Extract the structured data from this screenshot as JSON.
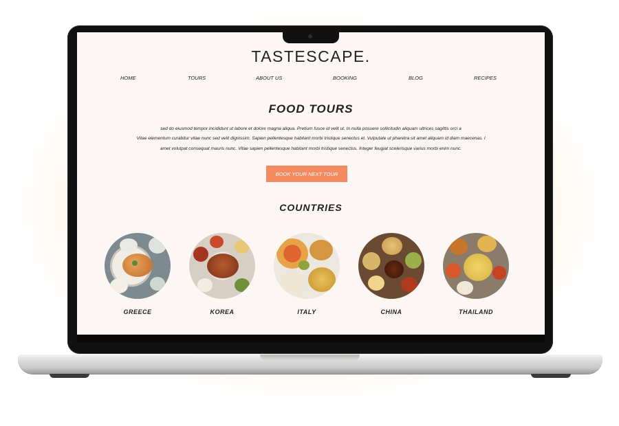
{
  "site": {
    "logo": "TASTESCAPE.",
    "nav": [
      "HOME",
      "TOURS",
      "ABOUT US",
      "BOOKING",
      "BLOG",
      "RECIPES"
    ],
    "hero": {
      "title": "FOOD TOURS",
      "lines": [
        "sed do eiusmod tempor incididunt ut labore et dolore magna aliqua. Pretium fusce id velit ut. In nulla posuere sollicitudin aliquam ultrices sagittis orci a",
        "Vitae elementum curabitur vitae nunc sed velit dignissim. Sapien pellentesque habitant morbi tristique senectus et. Vulputate ut pharetra sit amet aliquam id diam maecenas. l",
        "amet volutpat consequat mauris nunc. Vitae sapien pellentesque habitant morbi tristique senectus. Integer feugiat scelerisque varius morbi enim nunc."
      ],
      "cta_label": "BOOK YOUR NEXT TOUR"
    },
    "countries_title": "COUNTRIES",
    "countries": [
      {
        "label": "GREECE",
        "image": "greek-dish-photo"
      },
      {
        "label": "KOREA",
        "image": "korean-dish-photo"
      },
      {
        "label": "ITALY",
        "image": "italian-dish-photo"
      },
      {
        "label": "CHINA",
        "image": "chinese-dish-photo"
      },
      {
        "label": "THAILAND",
        "image": "thai-dish-photo"
      }
    ]
  },
  "colors": {
    "accent": "#f48a5f",
    "page_background": "#fcf7f4",
    "text": "#222222"
  }
}
